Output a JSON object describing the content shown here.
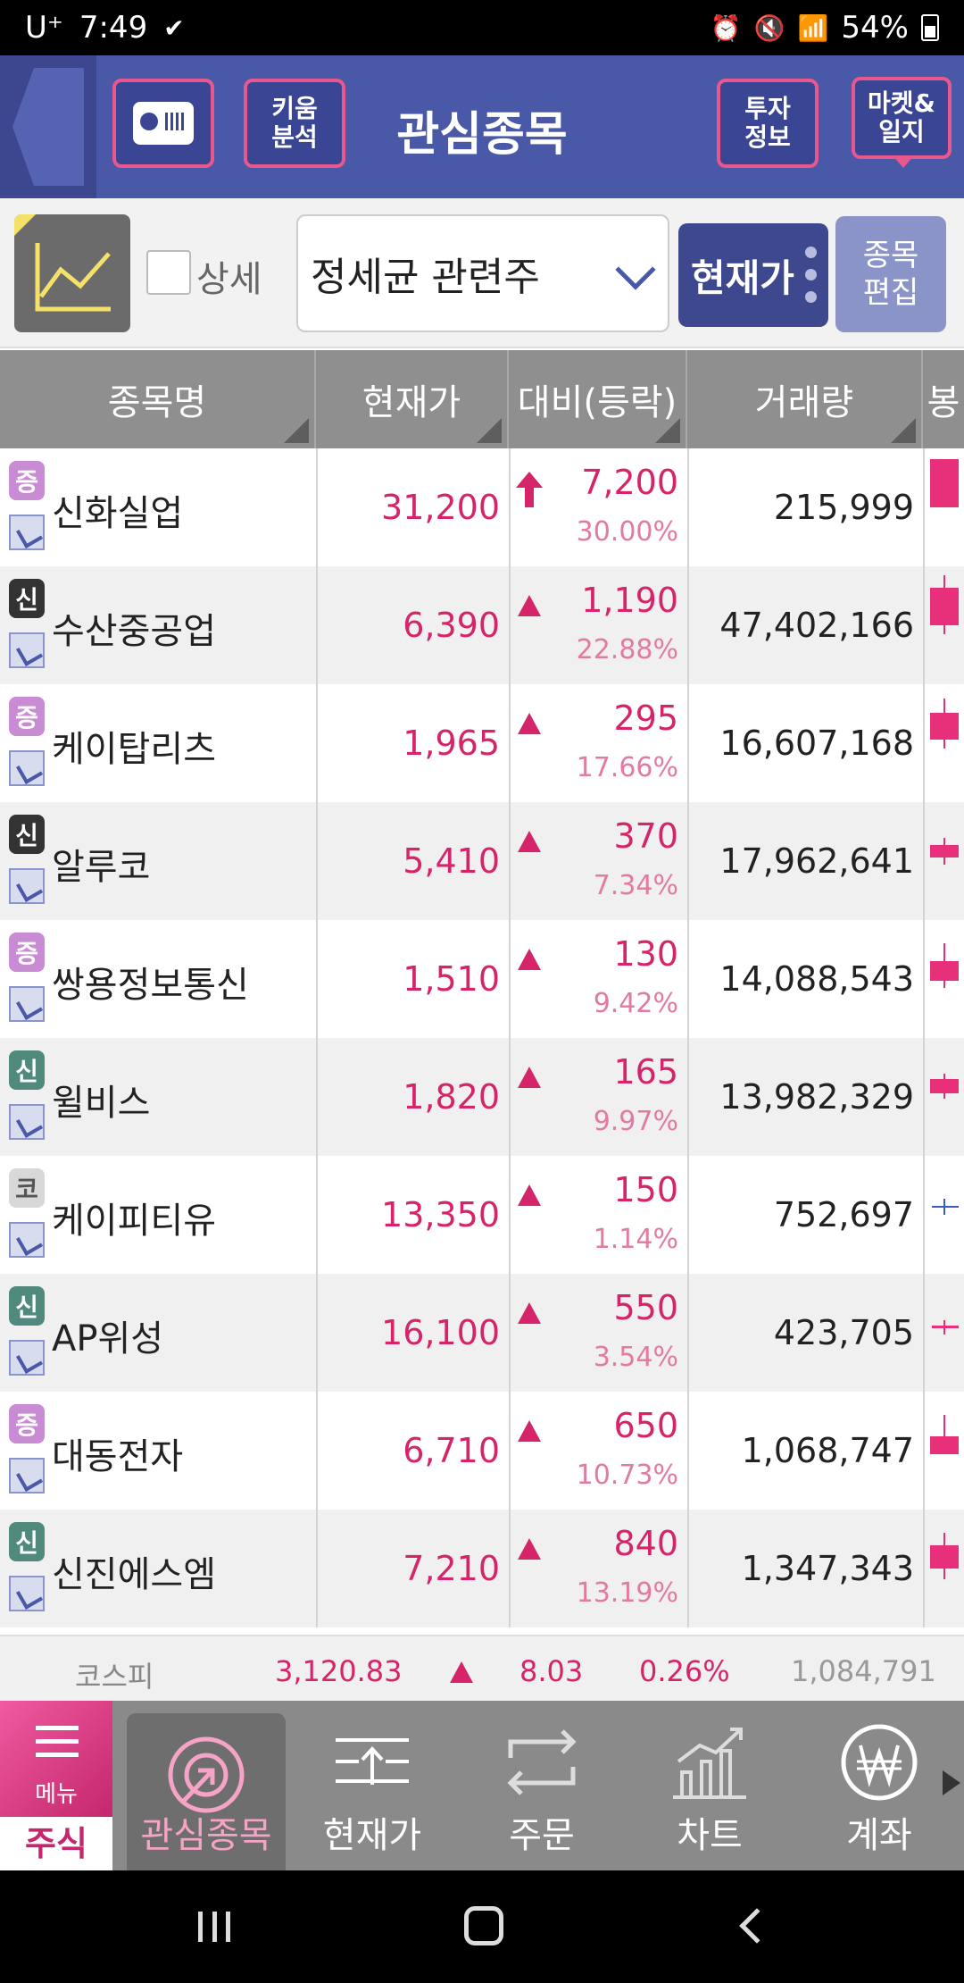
{
  "status_bar": {
    "carrier": "U⁺",
    "time": "7:49",
    "battery": "54%"
  },
  "header": {
    "title": "관심종목",
    "kiwoom_button": "키움\n분석",
    "invest_button": "투자\n정보",
    "market_button": "마켓&\n일지"
  },
  "toolbar": {
    "detail_label": "상세",
    "group_select_value": "정세균 관련주",
    "price_button": "현재가",
    "edit_button_line1": "종목",
    "edit_button_line2": "편집"
  },
  "table": {
    "headers": [
      "종목명",
      "현재가",
      "대비(등락)",
      "거래량",
      "봉"
    ],
    "rows": [
      {
        "badge": "증",
        "badge_type": "jeung",
        "name": "신화실업",
        "price": "31,200",
        "change": "7,200",
        "rate": "30.00%",
        "change_icon": "upper-limit-arrow",
        "volume": "215,999"
      },
      {
        "badge": "신",
        "badge_type": "sin",
        "name": "수산중공업",
        "price": "6,390",
        "change": "1,190",
        "rate": "22.88%",
        "change_icon": "up-triangle",
        "volume": "47,402,166"
      },
      {
        "badge": "증",
        "badge_type": "jeung",
        "name": "케이탑리츠",
        "price": "1,965",
        "change": "295",
        "rate": "17.66%",
        "change_icon": "up-triangle",
        "volume": "16,607,168"
      },
      {
        "badge": "신",
        "badge_type": "sin",
        "name": "알루코",
        "price": "5,410",
        "change": "370",
        "rate": "7.34%",
        "change_icon": "up-triangle",
        "volume": "17,962,641"
      },
      {
        "badge": "증",
        "badge_type": "jeung",
        "name": "쌍용정보통신",
        "price": "1,510",
        "change": "130",
        "rate": "9.42%",
        "change_icon": "up-triangle",
        "volume": "14,088,543"
      },
      {
        "badge": "신",
        "badge_type": "sin2",
        "name": "윌비스",
        "price": "1,820",
        "change": "165",
        "rate": "9.97%",
        "change_icon": "up-triangle",
        "volume": "13,982,329"
      },
      {
        "badge": "코",
        "badge_type": "ko",
        "name": "케이피티유",
        "price": "13,350",
        "change": "150",
        "rate": "1.14%",
        "change_icon": "up-triangle",
        "volume": "752,697"
      },
      {
        "badge": "신",
        "badge_type": "sin2",
        "name": "AP위성",
        "price": "16,100",
        "change": "550",
        "rate": "3.54%",
        "change_icon": "up-triangle",
        "volume": "423,705"
      },
      {
        "badge": "증",
        "badge_type": "jeung",
        "name": "대동전자",
        "price": "6,710",
        "change": "650",
        "rate": "10.73%",
        "change_icon": "up-triangle",
        "volume": "1,068,747"
      },
      {
        "badge": "신",
        "badge_type": "sin2",
        "name": "신진에스엠",
        "price": "7,210",
        "change": "840",
        "rate": "13.19%",
        "change_icon": "up-triangle",
        "volume": "1,347,343"
      }
    ]
  },
  "index_bar": {
    "name": "코스피",
    "value": "3,120.83",
    "change": "8.03",
    "rate": "0.26%",
    "volume": "1,084,791"
  },
  "bottom_nav": {
    "menu_label": "메뉴",
    "stock_tab": "주식",
    "items": [
      "관심종목",
      "현재가",
      "주문",
      "차트",
      "계좌"
    ]
  },
  "colors": {
    "header_bg": "#4a58a8",
    "up_red": "#d6246b",
    "accent_pink": "#e8588e"
  }
}
